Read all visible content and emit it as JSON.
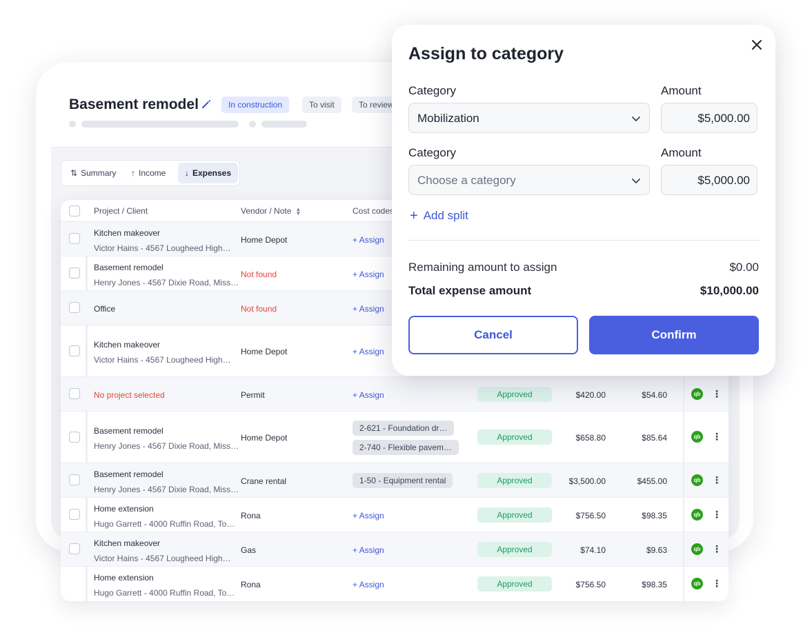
{
  "project": {
    "title": "Basement remodel",
    "statuses": [
      "In construction",
      "To visit",
      "To review"
    ]
  },
  "tabs": [
    {
      "label": "Summary",
      "icon": "sort-arrows-icon",
      "active": false
    },
    {
      "label": "Income",
      "icon": "arrow-up-icon",
      "active": false
    },
    {
      "label": "Expenses",
      "icon": "arrow-down-icon",
      "active": true
    }
  ],
  "table": {
    "headers": {
      "project": "Project / Client",
      "vendor": "Vendor / Note",
      "cost_codes": "Cost codes"
    },
    "rows": [
      {
        "project": "Kitchen makeover",
        "client": "Victor Hains - 4567 Lougheed High…",
        "vendor": "Home Depot",
        "assign": "+ Assign"
      },
      {
        "project": "Basement remodel",
        "client": "Henry Jones - 4567 Dixie Road, Miss…",
        "vendor": "Not found",
        "assign": "+ Assign"
      },
      {
        "project": "Office",
        "client": "",
        "vendor": "Not found",
        "assign": "+ Assign"
      },
      {
        "project": "Kitchen makeover",
        "client": "Victor Hains - 4567 Lougheed High…",
        "vendor": "Home Depot",
        "assign": "+ Assign"
      },
      {
        "project": "No project selected",
        "client": "",
        "vendor": "Permit",
        "assign": "+ Assign",
        "status": "Approved",
        "amount": "$420.00",
        "tax": "$54.60"
      },
      {
        "project": "Basement remodel",
        "client": "Henry Jones - 4567 Dixie Road, Miss…",
        "vendor": "Home Depot",
        "codes": [
          "2-621 - Foundation dr…",
          "2-740 - Flexible pavem…"
        ],
        "status": "Approved",
        "amount": "$658.80",
        "tax": "$85.64"
      },
      {
        "project": "Basement remodel",
        "client": "Henry Jones - 4567 Dixie Road, Miss…",
        "vendor": "Crane rental",
        "codes": [
          "1-50 - Equipment rental"
        ],
        "status": "Approved",
        "amount": "$3,500.00",
        "tax": "$455.00"
      },
      {
        "project": "Home extension",
        "client": "Hugo Garrett - 4000 Ruffin Road, To…",
        "vendor": "Rona",
        "assign": "+ Assign",
        "status": "Approved",
        "amount": "$756.50",
        "tax": "$98.35"
      },
      {
        "project": "Kitchen makeover",
        "client": "Victor Hains - 4567 Lougheed High…",
        "vendor": "Gas",
        "assign": "+ Assign",
        "status": "Approved",
        "amount": "$74.10",
        "tax": "$9.63"
      },
      {
        "project": "Home extension",
        "client": "Hugo Garrett - 4000 Ruffin Road, To…",
        "vendor": "Rona",
        "assign": "+ Assign",
        "status": "Approved",
        "amount": "$756.50",
        "tax": "$98.35"
      }
    ],
    "qb_label": "qb"
  },
  "modal": {
    "title": "Assign to category",
    "category_label": "Category",
    "amount_label": "Amount",
    "splits": [
      {
        "category": "Mobilization",
        "amount": "$5,000.00"
      },
      {
        "category": "Choose a category",
        "amount": "$5,000.00"
      }
    ],
    "add_split": "Add split",
    "remaining_label": "Remaining amount to assign",
    "remaining_value": "$0.00",
    "total_label": "Total expense amount",
    "total_value": "$10,000.00",
    "cancel": "Cancel",
    "confirm": "Confirm"
  },
  "colors": {
    "accent": "#4a5ee0",
    "error": "#e0463a",
    "approved_bg": "#dcf3ea",
    "approved_text": "#1d9a66",
    "quickbooks": "#2ca01c"
  }
}
